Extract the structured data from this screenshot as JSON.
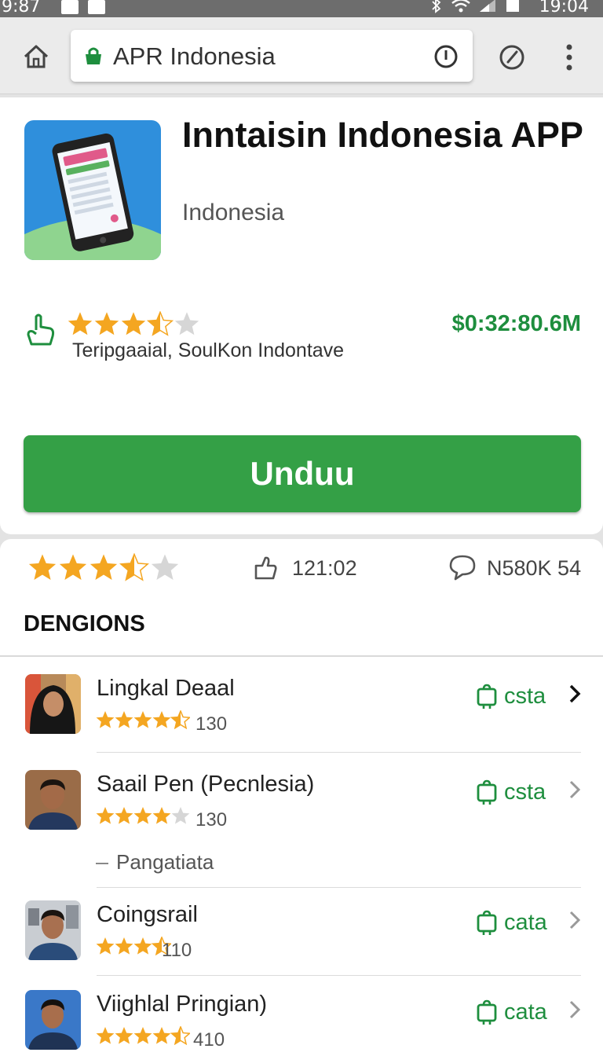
{
  "status_bar": {
    "time_left": "9:87",
    "time_right": "19:04"
  },
  "toolbar": {
    "url_text": "APR Indonesia"
  },
  "app": {
    "title": "Inntaisin Indonesia APP",
    "subtitle": "Indonesia",
    "rating": 3.5,
    "price": "$0:32:80.6M",
    "developer": "Teripgaaial, SoulKon Indontave",
    "install_label": "Unduu"
  },
  "stats": {
    "rating": 3.5,
    "downloads": "121:02",
    "reviews": "N580K 54"
  },
  "section_title": "DENGIONS",
  "group_label": "Pangatiata",
  "items": [
    {
      "name": "Lingkal Deaal",
      "rating": 4.5,
      "count": "130",
      "action": "csta",
      "icon": "shopping-bag-icon"
    },
    {
      "name": "Saail Pen (Pecnlesia)",
      "rating": 4,
      "count": "130",
      "action": "csta",
      "icon": "shopping-bag-icon"
    },
    {
      "name": "Coingsrail",
      "rating": 3.5,
      "count": "110",
      "action": "cata",
      "icon": "shopping-bag-icon"
    },
    {
      "name": "Viighlal Pringian)",
      "rating": 4.5,
      "count": "410",
      "action": "cata",
      "icon": "shopping-bag-icon"
    }
  ],
  "colors": {
    "accent_green": "#34a046",
    "text_green": "#1e8e3e",
    "star": "#f4a621"
  }
}
